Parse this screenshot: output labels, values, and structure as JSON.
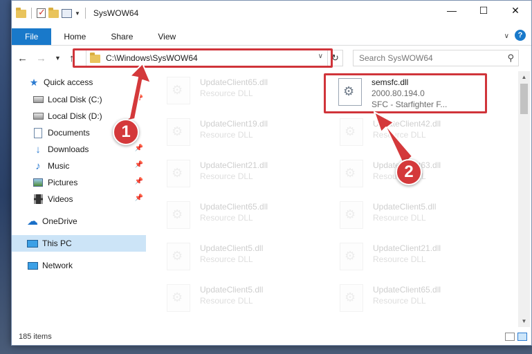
{
  "window": {
    "title": "SysWOW64"
  },
  "ribbon": {
    "tabs": [
      "File",
      "Home",
      "Share",
      "View"
    ]
  },
  "address": {
    "path": "C:\\Windows\\SysWOW64"
  },
  "search": {
    "placeholder": "Search SysWOW64"
  },
  "nav": {
    "items": [
      {
        "label": "Quick access"
      },
      {
        "label": "Local Disk (C:)"
      },
      {
        "label": "Local Disk (D:)"
      },
      {
        "label": "Documents"
      },
      {
        "label": "Downloads"
      },
      {
        "label": "Music"
      },
      {
        "label": "Pictures"
      },
      {
        "label": "Videos"
      },
      {
        "label": "OneDrive"
      },
      {
        "label": "This PC"
      },
      {
        "label": "Network"
      }
    ]
  },
  "files": {
    "target": {
      "name": "semsfc.dll",
      "version": "2000.80.194.0",
      "desc": "SFC - Starfighter F..."
    },
    "col1": [
      {
        "name": "UpdateClient65.dll",
        "desc": "Resource DLL"
      },
      {
        "name": "UpdateClient19.dll",
        "desc": "Resource DLL"
      },
      {
        "name": "UpdateClient21.dll",
        "desc": "Resource DLL"
      },
      {
        "name": "UpdateClient65.dll",
        "desc": "Resource DLL"
      },
      {
        "name": "UpdateClient5.dll",
        "desc": "Resource DLL"
      },
      {
        "name": "UpdateClient5.dll",
        "desc": "Resource DLL"
      }
    ],
    "col2": [
      {
        "name": "UpdateClient42.dll",
        "desc": "Resource DLL"
      },
      {
        "name": "UpdateClient63.dll",
        "desc": "Resource DLL"
      },
      {
        "name": "UpdateClient5.dll",
        "desc": "Resource DLL"
      },
      {
        "name": "UpdateClient21.dll",
        "desc": "Resource DLL"
      },
      {
        "name": "UpdateClient65.dll",
        "desc": "Resource DLL"
      }
    ]
  },
  "status": {
    "count": "185 items"
  },
  "annotations": {
    "badge1": "1",
    "badge2": "2"
  },
  "colors": {
    "highlight": "#d0343a",
    "accent": "#1979ca"
  }
}
